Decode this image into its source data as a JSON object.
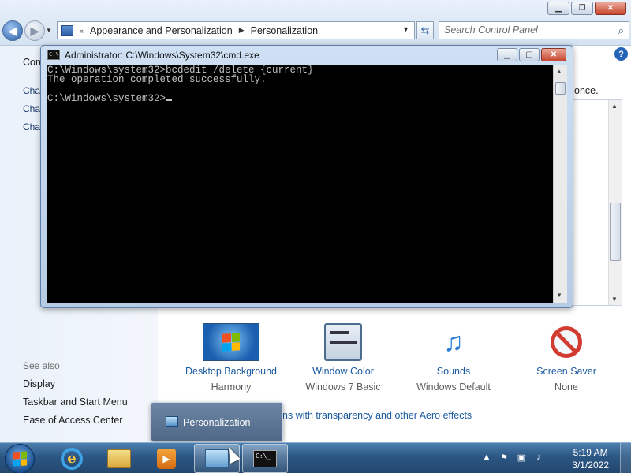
{
  "control_panel": {
    "breadcrumb": {
      "overflow": "«",
      "items": [
        "Appearance and Personalization",
        "Personalization"
      ]
    },
    "search_placeholder": "Search Control Panel",
    "left_pane": {
      "partial_heading": "Con",
      "partial_links": [
        "Cha",
        "Cha",
        "Cha"
      ],
      "see_also_title": "See also",
      "see_also_links": [
        "Display",
        "Taskbar and Start Menu",
        "Ease of Access Center"
      ]
    },
    "main": {
      "partial_text": "once.",
      "tiles": [
        {
          "label": "Desktop Background",
          "sub": "Harmony"
        },
        {
          "label": "Window Color",
          "sub": "Windows 7 Basic"
        },
        {
          "label": "Sounds",
          "sub": "Windows Default"
        },
        {
          "label": "Screen Saver",
          "sub": "None"
        }
      ],
      "transparency_link": "ns with transparency and other Aero effects"
    }
  },
  "cmd": {
    "title": "Administrator: C:\\Windows\\System32\\cmd.exe",
    "icon_text": "C:\\",
    "lines": [
      "C:\\Windows\\system32>bcdedit /delete {current}",
      "The operation completed successfully.",
      "",
      "C:\\Windows\\system32>"
    ]
  },
  "taskbar": {
    "thumbnail_label": "Personalization",
    "cmd_icon_text": "C:\\_",
    "clock": {
      "time": "5:19 AM",
      "date": "3/1/2022"
    }
  },
  "colors": {
    "link_blue": "#1a5aa0",
    "console_bg": "#000000",
    "console_text": "#c0c0c0"
  }
}
